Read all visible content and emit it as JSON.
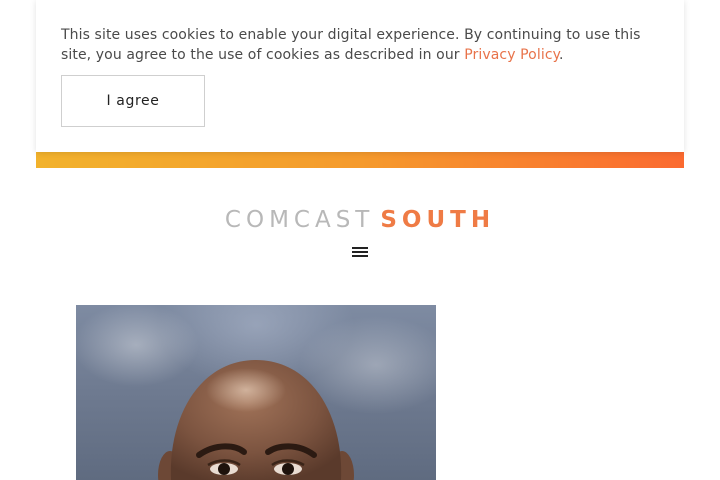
{
  "cookie_banner": {
    "text_before_link": "This site uses cookies to enable your digital experience. By continuing to use this site, you agree to the use of cookies as described in our ",
    "link_text": "Privacy Policy",
    "text_after_link": ".",
    "agree_label": "I agree"
  },
  "brand": {
    "name_part1": "COMCAST",
    "name_part2": "SOUTH"
  },
  "nav": {
    "menu_icon": "hamburger-menu-icon"
  },
  "colors": {
    "accent": "#ef7b45",
    "link": "#e8734a",
    "gradient_start": "#f2b22c",
    "gradient_end": "#fb6a30",
    "brand_gray": "#b8b8b8"
  }
}
